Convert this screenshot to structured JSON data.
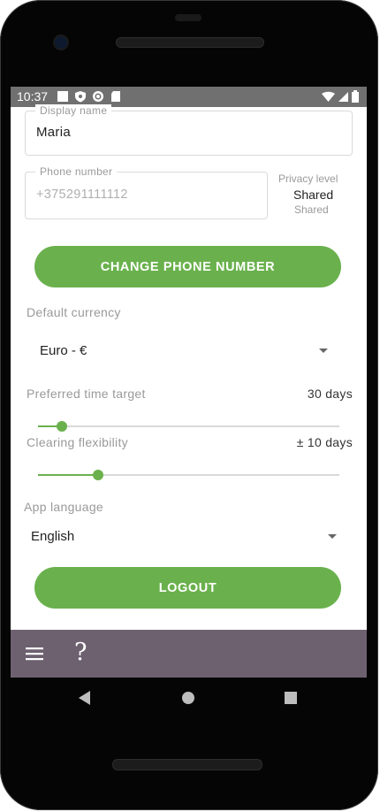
{
  "status_bar": {
    "time": "10:37",
    "left_icons": [
      "square-notification-icon",
      "shield-icon",
      "sync-icon",
      "sd-card-icon"
    ],
    "right_icons": [
      "wifi-icon",
      "signal-icon",
      "battery-icon"
    ]
  },
  "form": {
    "display_name": {
      "label": "Display name",
      "value": "Maria"
    },
    "phone_number": {
      "label": "Phone number",
      "value": "+375291111112"
    },
    "privacy": {
      "label": "Privacy level",
      "value": "Shared",
      "sub_value": "Shared"
    },
    "change_phone_button": "CHANGE PHONE NUMBER",
    "default_currency": {
      "label": "Default currency",
      "value": "Euro - €"
    },
    "preferred_time_target": {
      "label": "Preferred time target",
      "value": "30 days",
      "slider_fraction": 0.08
    },
    "clearing_flexibility": {
      "label": "Clearing flexibility",
      "value": "± 10 days",
      "slider_fraction": 0.2
    },
    "app_language": {
      "label": "App language",
      "value": "English"
    },
    "logout_button": "LOGOUT"
  },
  "bottom_bar": {
    "icons": [
      "menu-icon",
      "help-icon"
    ],
    "help_glyph": "?"
  },
  "colors": {
    "accent": "#6ab14d",
    "bottom_bar": "#6d6170",
    "status_bar": "#707070"
  }
}
